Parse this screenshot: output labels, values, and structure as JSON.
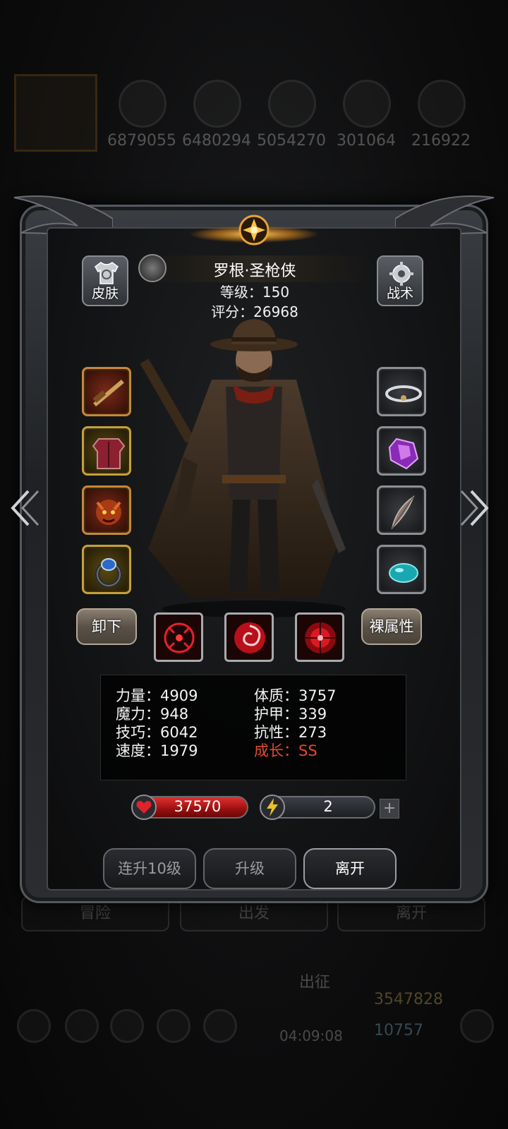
{
  "background": {
    "resources": [
      "6879055",
      "6480294",
      "5054270",
      "301064",
      "216922"
    ],
    "tabs": [
      "冒险",
      "出发",
      "离开"
    ],
    "dispatch_label": "出征",
    "timer": "04:09:08",
    "gold": "3547828",
    "gems": "10757"
  },
  "header": {
    "skin_label": "皮肤",
    "tactics_label": "战术",
    "hero_name": "罗根·圣枪侠",
    "level_text": "等级：150",
    "score_text": "评分：26968"
  },
  "equipment": {
    "left": [
      {
        "icon": "rifle-icon"
      },
      {
        "icon": "armor-icon"
      },
      {
        "icon": "demon-charm-icon"
      },
      {
        "icon": "sapphire-ring-icon"
      }
    ],
    "right": [
      {
        "icon": "cloud-halo-icon"
      },
      {
        "icon": "purple-crystal-icon"
      },
      {
        "icon": "feather-icon"
      },
      {
        "icon": "teal-gem-icon"
      }
    ]
  },
  "actions": {
    "unequip_label": "卸下",
    "base_attr_label": "裸属性",
    "skills": [
      "crosshair-skill-icon",
      "vortex-skill-icon",
      "target-skill-icon"
    ]
  },
  "stats": {
    "left": [
      "力量：4909",
      "魔力：948",
      "技巧：6042",
      "速度：1979"
    ],
    "right": [
      "体质：3757",
      "护甲：339",
      "抗性：273",
      "成长：SS"
    ]
  },
  "resources": {
    "hp": "37570",
    "energy": "2",
    "plus_label": "+"
  },
  "buttons": {
    "upgrade10": "连升10级",
    "upgrade": "升级",
    "leave": "离开"
  },
  "colors": {
    "growth": "#e24a2a",
    "hp": "#d62828",
    "energy_icon": "#e8c22a"
  }
}
